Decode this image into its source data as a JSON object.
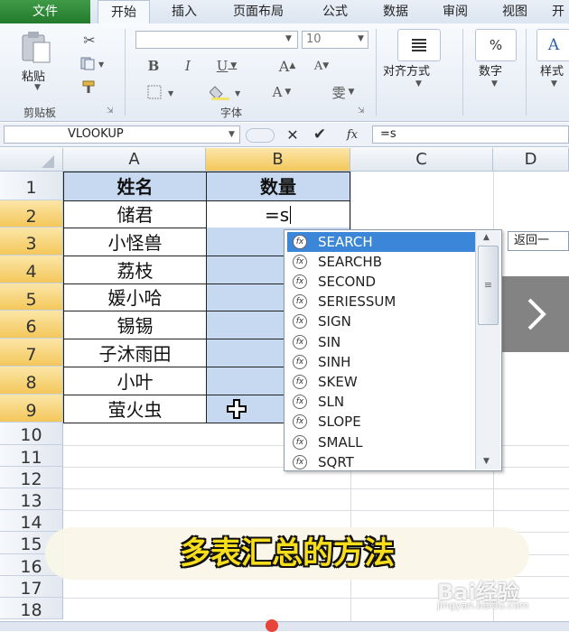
{
  "ribbon_tabs": [
    "文件",
    "开始",
    "插入",
    "页面布局",
    "公式",
    "数据",
    "审阅",
    "视图",
    "开"
  ],
  "clipboard": {
    "paste_label": "粘贴",
    "group_label": "剪贴板"
  },
  "font": {
    "name_value": "",
    "size_value": "10",
    "group_label": "字体"
  },
  "alignment": {
    "label": "对齐方式"
  },
  "number": {
    "label": "数字"
  },
  "styles": {
    "label": "样式"
  },
  "formula_bar": {
    "name_box": "VLOOKUP",
    "formula": "=s",
    "fx_label": "fx"
  },
  "columns": [
    "A",
    "B",
    "C",
    "D"
  ],
  "rows": [
    "1",
    "2",
    "3",
    "4",
    "5",
    "6",
    "7",
    "8",
    "9",
    "10",
    "11",
    "12",
    "13",
    "14",
    "15",
    "16",
    "17",
    "18"
  ],
  "cells": {
    "A1": "姓名",
    "B1": "数量",
    "A2": "储君",
    "B2": "=s",
    "A3": "小怪兽",
    "A4": "荔枝",
    "A5": "媛小哈",
    "A6": "锡锡",
    "A7": "子沐雨田",
    "A8": "小叶",
    "A9": "萤火虫"
  },
  "autocomplete": {
    "items": [
      "SEARCH",
      "SEARCHB",
      "SECOND",
      "SERIESSUM",
      "SIGN",
      "SIN",
      "SINH",
      "SKEW",
      "SLN",
      "SLOPE",
      "SMALL",
      "SQRT"
    ],
    "selected": "SEARCH",
    "tooltip": "返回一"
  },
  "caption": "多表汇总的方法",
  "watermark": {
    "brand": "Bai经验",
    "url": "jingyan.baidu.com"
  },
  "colors": {
    "file_tab": "#2e8b38",
    "header_fill": "#c6d9f1",
    "selected_row": "#f4c75a",
    "selection": "#3b86d8",
    "caption_text": "#f7dd1a"
  },
  "icons": [
    "paste-icon",
    "cut-icon",
    "copy-icon",
    "format-painter-icon",
    "bold-icon",
    "italic-icon",
    "underline-icon",
    "grow-font-icon",
    "shrink-font-icon",
    "border-icon",
    "fill-color-icon",
    "font-color-icon",
    "phonetic-icon",
    "align-icon",
    "percent-icon",
    "style-icon",
    "cancel-icon",
    "enter-icon",
    "function-icon",
    "fill-cursor-icon",
    "chevron-right-icon"
  ]
}
